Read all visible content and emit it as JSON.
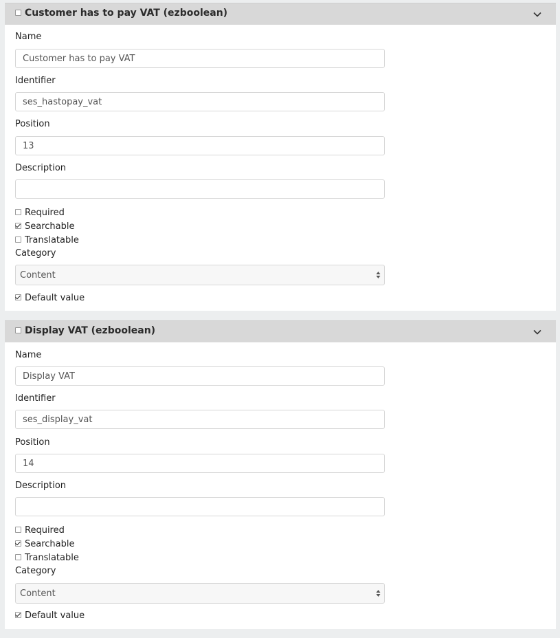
{
  "panels": [
    {
      "title": "Customer has to pay VAT (ezboolean)",
      "name_label": "Name",
      "name_value": "Customer has to pay VAT",
      "identifier_label": "Identifier",
      "identifier_value": "ses_hastopay_vat",
      "position_label": "Position",
      "position_value": "13",
      "description_label": "Description",
      "description_value": "",
      "required_label": "Required",
      "required_checked": false,
      "searchable_label": "Searchable",
      "searchable_checked": true,
      "translatable_label": "Translatable",
      "translatable_checked": false,
      "category_label": "Category",
      "category_value": "Content",
      "default_value_label": "Default value",
      "default_value_checked": true
    },
    {
      "title": "Display VAT (ezboolean)",
      "name_label": "Name",
      "name_value": "Display VAT",
      "identifier_label": "Identifier",
      "identifier_value": "ses_display_vat",
      "position_label": "Position",
      "position_value": "14",
      "description_label": "Description",
      "description_value": "",
      "required_label": "Required",
      "required_checked": false,
      "searchable_label": "Searchable",
      "searchable_checked": true,
      "translatable_label": "Translatable",
      "translatable_checked": false,
      "category_label": "Category",
      "category_value": "Content",
      "default_value_label": "Default value",
      "default_value_checked": true
    }
  ],
  "icons": {
    "header_toggle": "chevron-down-icon",
    "select_arrows": "up-down-arrows-icon"
  }
}
